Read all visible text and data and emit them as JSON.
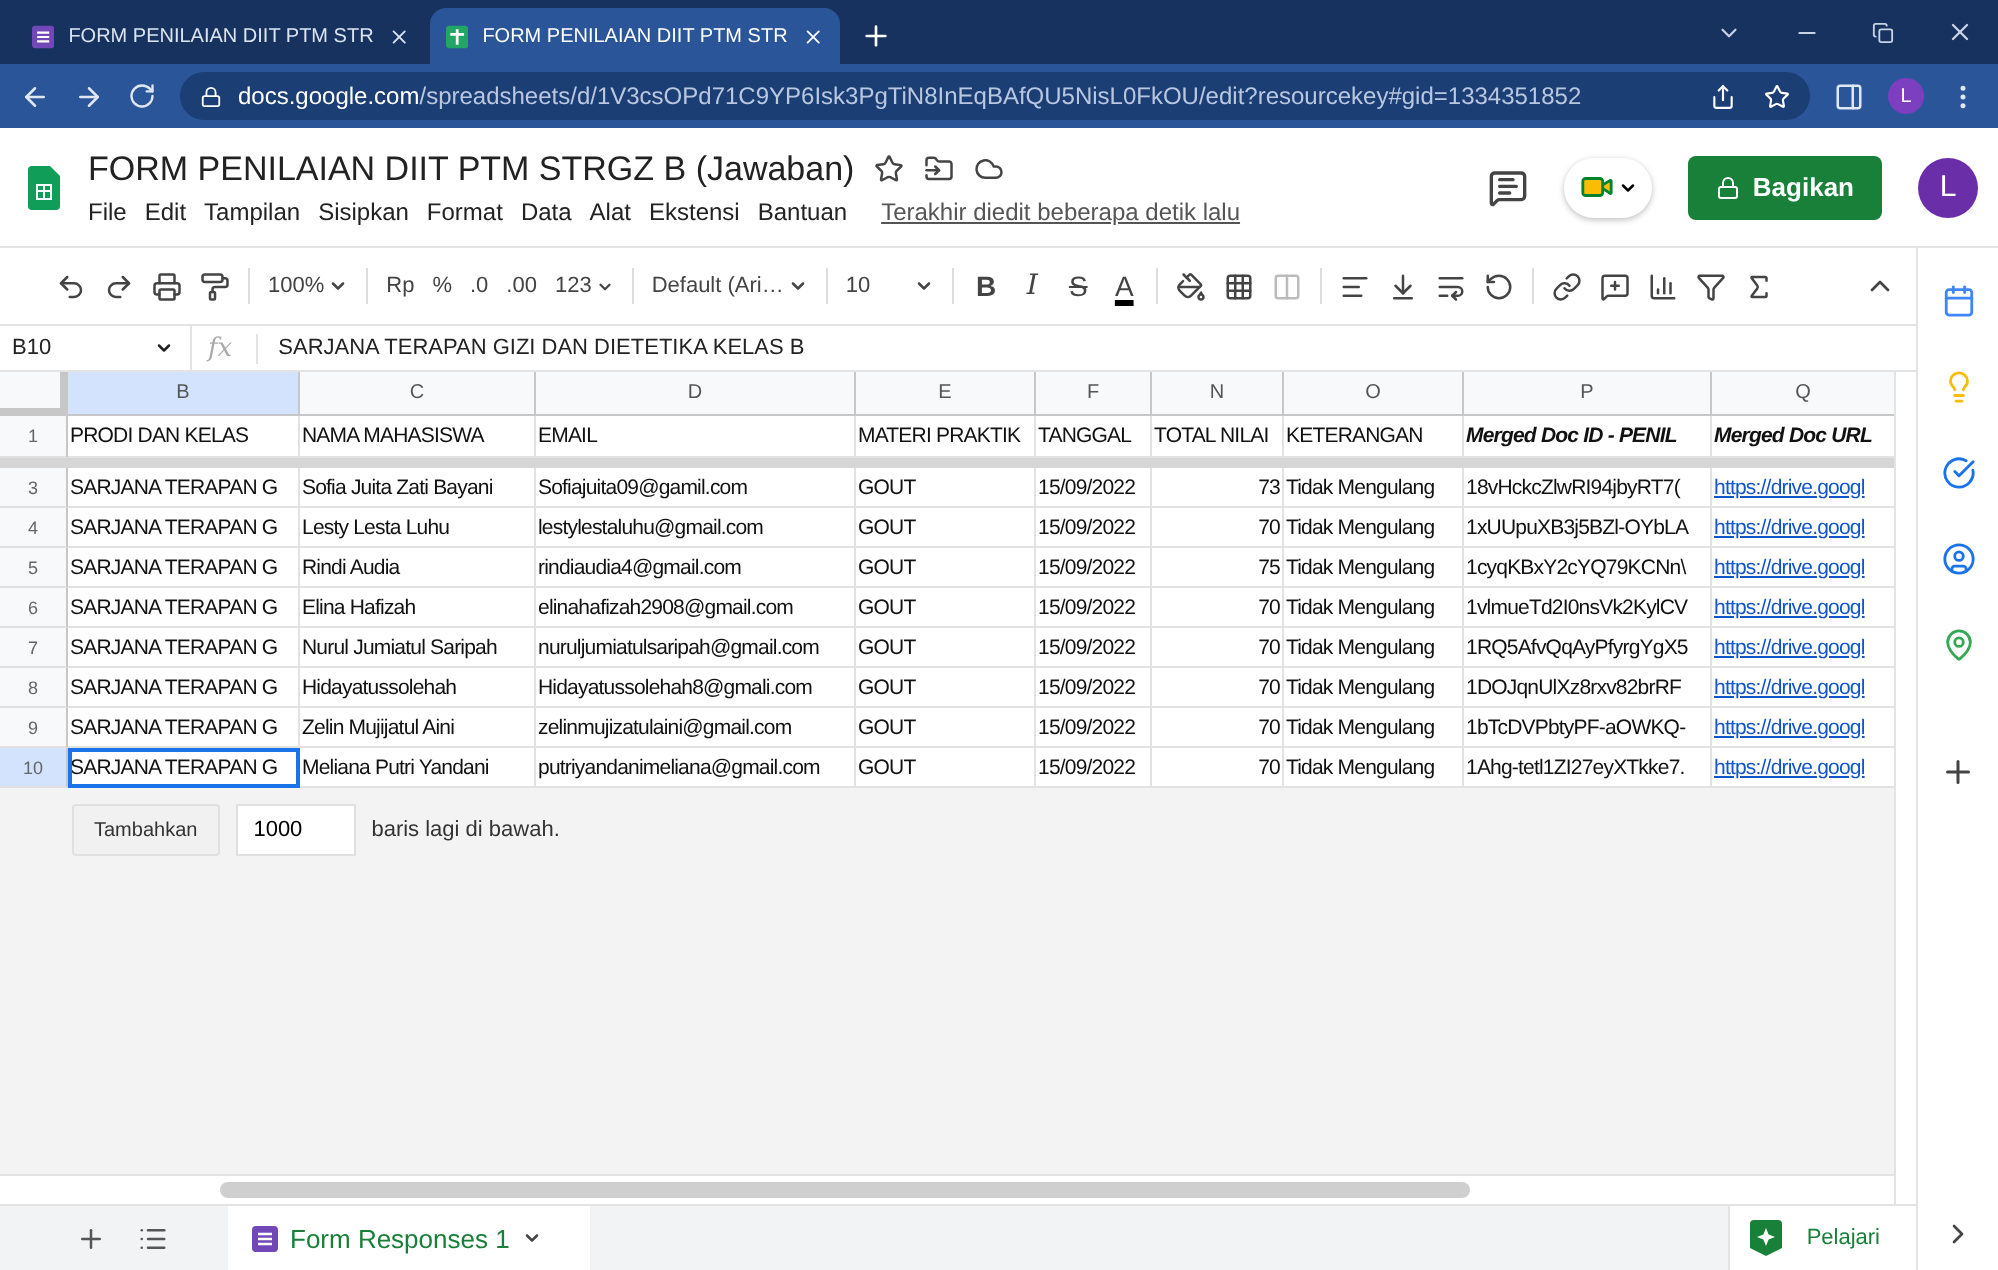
{
  "browser": {
    "tabs": [
      {
        "title": "FORM PENILAIAN DIIT PTM STR",
        "kind": "forms",
        "selected": false
      },
      {
        "title": "FORM PENILAIAN DIIT PTM STR",
        "kind": "sheets",
        "selected": true
      }
    ],
    "url_host": "docs.google.com",
    "url_path": "/spreadsheets/d/1V3csOPd71C9YP6Isk3PgTiN8InEqBAfQU5NisL0FkOU/edit?resourcekey#gid=1334351852",
    "profile": "L"
  },
  "document": {
    "title": "FORM PENILAIAN DIIT PTM STRGZ B (Jawaban)",
    "menu": [
      "File",
      "Edit",
      "Tampilan",
      "Sisipkan",
      "Format",
      "Data",
      "Alat",
      "Ekstensi",
      "Bantuan"
    ],
    "last_edit": "Terakhir diedit beberapa detik lalu",
    "share": "Bagikan",
    "avatar": "L"
  },
  "toolbar": {
    "zoom": "100%",
    "number_formats": [
      "Rp",
      "%",
      ".0",
      ".00"
    ],
    "more_formats": "123",
    "font": "Default (Ari…",
    "font_size": "10",
    "styles": [
      {
        "kind": "bold",
        "label": "B"
      },
      {
        "kind": "italic",
        "label": "I"
      },
      {
        "kind": "strike",
        "label": "S"
      },
      {
        "kind": "color",
        "label": "A"
      }
    ]
  },
  "formula_bar": {
    "cell": "B10",
    "label": "fx",
    "value": "SARJANA TERAPAN GIZI DAN DIETETIKA KELAS B"
  },
  "columns": [
    {
      "letter": "B",
      "selected": true,
      "kind": "text"
    },
    {
      "letter": "C",
      "selected": false,
      "kind": "text"
    },
    {
      "letter": "D",
      "selected": false,
      "kind": "text"
    },
    {
      "letter": "E",
      "selected": false,
      "kind": "text"
    },
    {
      "letter": "F",
      "selected": false,
      "kind": "text"
    },
    {
      "letter": "N",
      "selected": false,
      "kind": "number"
    },
    {
      "letter": "O",
      "selected": false,
      "kind": "text"
    },
    {
      "letter": "P",
      "selected": false,
      "kind": "text"
    },
    {
      "letter": "Q",
      "selected": false,
      "kind": "link"
    }
  ],
  "header_row": {
    "number": "1",
    "cells": [
      {
        "text": "PRODI  DAN KELAS",
        "emphasis": false
      },
      {
        "text": "NAMA MAHASISWA",
        "emphasis": false
      },
      {
        "text": "EMAIL",
        "emphasis": false
      },
      {
        "text": "MATERI PRAKTIK",
        "emphasis": false
      },
      {
        "text": "TANGGAL",
        "emphasis": false
      },
      {
        "text": "TOTAL NILAI",
        "emphasis": false
      },
      {
        "text": "KETERANGAN",
        "emphasis": false
      },
      {
        "text": "Merged Doc ID - PENIL",
        "emphasis": true
      },
      {
        "text": "Merged Doc URL",
        "emphasis": true
      }
    ]
  },
  "rows": [
    {
      "number": "3",
      "selected": false,
      "cells": [
        "SARJANA TERAPAN G",
        "Sofia Juita Zati Bayani",
        "Sofiajuita09@gamil.com",
        "GOUT",
        "15/09/2022",
        "73",
        "Tidak Mengulang",
        "18vHckcZlwRI94jbyRT7(",
        "https://drive.googl"
      ]
    },
    {
      "number": "4",
      "selected": false,
      "cells": [
        "SARJANA TERAPAN G",
        "Lesty Lesta Luhu",
        "lestylestaluhu@gmail.com",
        "GOUT",
        "15/09/2022",
        "70",
        "Tidak Mengulang",
        "1xUUpuXB3j5BZl-OYbLA",
        "https://drive.googl"
      ]
    },
    {
      "number": "5",
      "selected": false,
      "cells": [
        "SARJANA TERAPAN G",
        "Rindi Audia",
        "rindiaudia4@gmail.com",
        "GOUT",
        "15/09/2022",
        "75",
        "Tidak Mengulang",
        "1cyqKBxY2cYQ79KCNn\\",
        "https://drive.googl"
      ]
    },
    {
      "number": "6",
      "selected": false,
      "cells": [
        "SARJANA TERAPAN G",
        "Elina Hafizah",
        "elinahafizah2908@gmail.com",
        "GOUT",
        "15/09/2022",
        "70",
        "Tidak Mengulang",
        "1vlmueTd2I0nsVk2KylCV",
        "https://drive.googl"
      ]
    },
    {
      "number": "7",
      "selected": false,
      "cells": [
        "SARJANA TERAPAN G",
        "Nurul Jumiatul Saripah",
        "nuruljumiatulsaripah@gmail.com",
        "GOUT",
        "15/09/2022",
        "70",
        "Tidak Mengulang",
        "1RQ5AfvQqAyPfyrgYgX5",
        "https://drive.googl"
      ]
    },
    {
      "number": "8",
      "selected": false,
      "cells": [
        "SARJANA TERAPAN G",
        "Hidayatussolehah",
        "Hidayatussolehah8@gmali.com",
        "GOUT",
        "15/09/2022",
        "70",
        "Tidak Mengulang",
        "1DOJqnUlXz8rxv82brRF",
        "https://drive.googl"
      ]
    },
    {
      "number": "9",
      "selected": false,
      "cells": [
        "SARJANA TERAPAN G",
        "Zelin Mujijatul Aini",
        "zelinmujizatulaini@gmail.com",
        "GOUT",
        "15/09/2022",
        "70",
        "Tidak Mengulang",
        "1bTcDVPbtyPF-aOWKQ-",
        "https://drive.googl"
      ]
    },
    {
      "number": "10",
      "selected": true,
      "cells": [
        "SARJANA TERAPAN G",
        "Meliana Putri Yandani",
        "putriyandanimeliana@gmail.com",
        "GOUT",
        "15/09/2022",
        "70",
        "Tidak Mengulang",
        "1Ahg-tetl1ZI27eyXTkke7.",
        "https://drive.googl"
      ]
    }
  ],
  "add_rows": {
    "button": "Tambahkan",
    "value": "1000",
    "suffix": "baris lagi di bawah."
  },
  "sheet_tabs": [
    {
      "label": "Form Responses 1",
      "selected": true
    }
  ],
  "explore": "Pelajari"
}
